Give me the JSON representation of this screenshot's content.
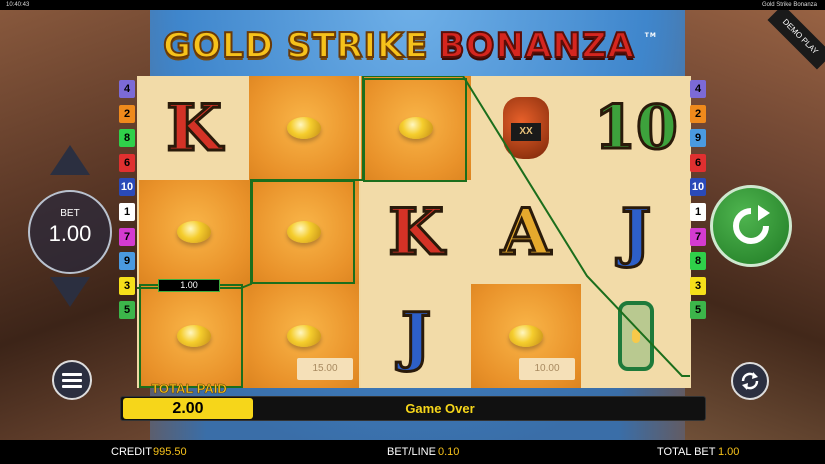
{
  "status_bar": {
    "time": "10:40:43",
    "app_title": "Gold Strike Bonanza"
  },
  "logo": {
    "part1": "GOLD STRIKE",
    "part2": "BONANZA",
    "tm": "TM"
  },
  "demo_badge": "DEMO PLAY",
  "reels": [
    [
      "K",
      "gold-nugget",
      "gold-nugget"
    ],
    [
      "gold-nugget",
      "gold-nugget",
      "gold-nugget"
    ],
    [
      "gold-nugget",
      "K",
      "J"
    ],
    [
      "whiskey-jug",
      "A",
      "gold-nugget"
    ],
    [
      "10",
      "J",
      "lantern"
    ]
  ],
  "jug_label": "XX",
  "prize_values": {
    "reel2": "15.00",
    "reel4": "10.00"
  },
  "win_tag": "1.00",
  "paylines_left": [
    "4",
    "2",
    "8",
    "6",
    "10",
    "1",
    "7",
    "9",
    "3",
    "5"
  ],
  "paylines_right": [
    "4",
    "2",
    "9",
    "6",
    "10",
    "1",
    "7",
    "8",
    "3",
    "5"
  ],
  "payline_colors": {
    "1": "#ffffff",
    "2": "#f08a1c",
    "3": "#f6e01a",
    "4": "#7c6ad6",
    "5": "#3cb54a",
    "6": "#e03030",
    "7": "#d43bd0",
    "8": "#2fd04a",
    "9": "#4a9ae0",
    "10": "#2a4ab8"
  },
  "bet_widget": {
    "label": "BET",
    "value": "1.00"
  },
  "total_paid": {
    "label": "TOTAL PAID",
    "value": "2.00"
  },
  "message": "Game Over",
  "footer": {
    "credit_label": "CREDIT",
    "credit_value": "995.50",
    "betline_label": "BET/LINE",
    "betline_value": "0.10",
    "totalbet_label": "TOTAL BET",
    "totalbet_value": "1.00"
  },
  "colors": {
    "accent_yellow": "#f6d61a",
    "spin_green": "#2e8f32",
    "win_line_green": "#1c6e1c"
  }
}
